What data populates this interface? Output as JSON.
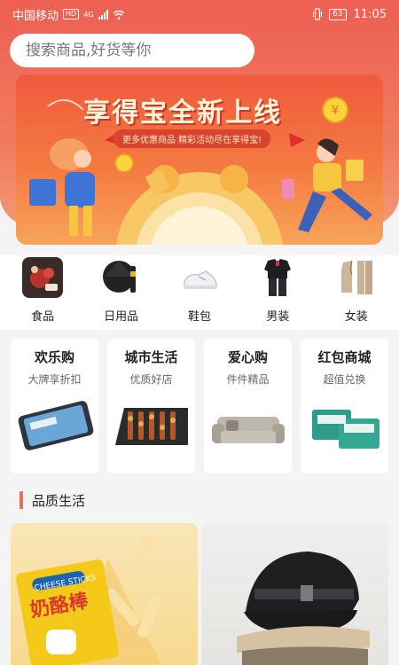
{
  "status_bar": {
    "carrier": "中国移动",
    "hd": "HD",
    "network": "4G",
    "battery": "63",
    "time": "11:05"
  },
  "search": {
    "placeholder": "搜索商品,好货等你"
  },
  "banner": {
    "title": "享得宝全新上线",
    "subtitle": "更多优惠商品 精彩活动尽在享得宝!"
  },
  "categories": [
    {
      "label": "食品",
      "icon": "food-icon"
    },
    {
      "label": "日用品",
      "icon": "umbrella-icon"
    },
    {
      "label": "鞋包",
      "icon": "shoe-icon"
    },
    {
      "label": "男装",
      "icon": "menswear-icon"
    },
    {
      "label": "女装",
      "icon": "womenswear-icon"
    }
  ],
  "features": [
    {
      "title": "欢乐购",
      "subtitle": "大牌享折扣",
      "icon": "phone-icon"
    },
    {
      "title": "城市生活",
      "subtitle": "优质好店",
      "icon": "skewers-icon"
    },
    {
      "title": "爱心购",
      "subtitle": "件件精品",
      "icon": "sofa-icon"
    },
    {
      "title": "红包商城",
      "subtitle": "超值兑换",
      "icon": "tissue-icon"
    }
  ],
  "section": {
    "title": "品质生活"
  },
  "products": [
    {
      "icon": "cheese-sticks-icon",
      "brand_text": "CHEESE STICKS",
      "name_text": "奶酪棒"
    },
    {
      "icon": "cap-icon"
    }
  ],
  "colors": {
    "header_top": "#ee5f52",
    "header_bottom": "#f39a74",
    "accent_bar": "#e2705d"
  }
}
